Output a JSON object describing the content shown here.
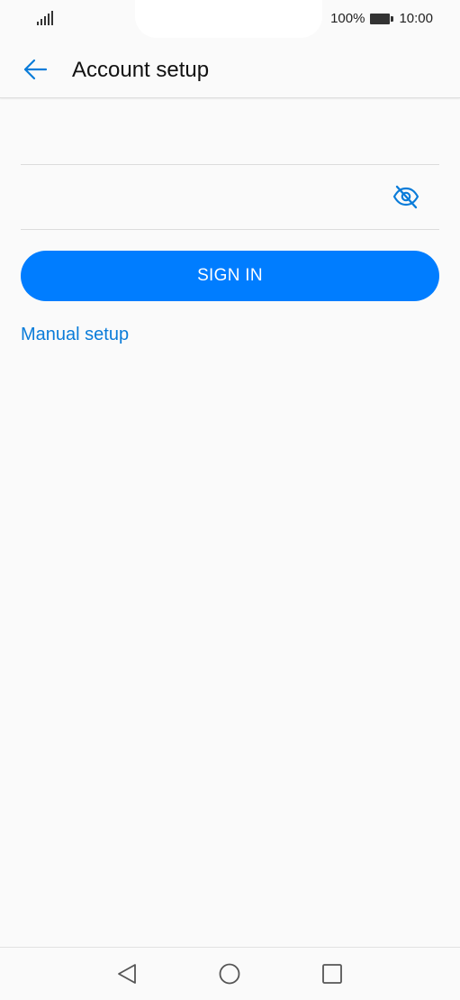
{
  "status_bar": {
    "battery_percent": "100%",
    "time": "10:00"
  },
  "app_bar": {
    "title": "Account setup"
  },
  "form": {
    "email_placeholder": "",
    "password_placeholder": "",
    "sign_in_label": "SIGN IN",
    "manual_setup_label": "Manual setup"
  },
  "colors": {
    "accent": "#007dff",
    "link": "#0a7cd9",
    "background": "#fafafa"
  },
  "icons": {
    "back": "arrow-left-icon",
    "password_visibility": "eye-off-icon",
    "nav_back": "triangle-back-icon",
    "nav_home": "circle-home-icon",
    "nav_recents": "square-recents-icon"
  }
}
